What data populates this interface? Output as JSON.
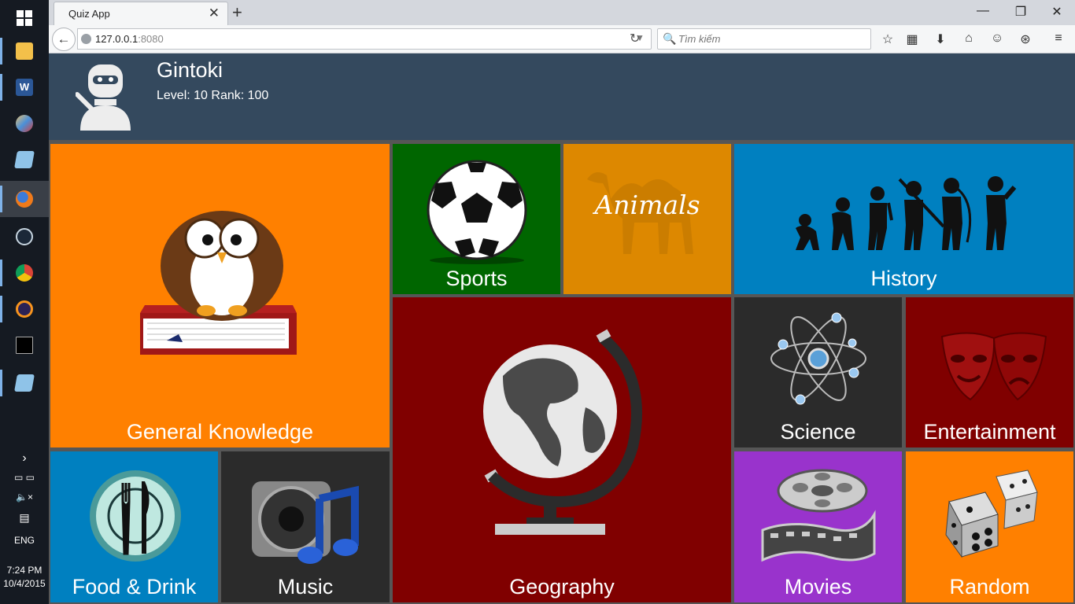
{
  "browser": {
    "tab_title": "Quiz App",
    "url_host": "127.0.0.1",
    "url_port": ":8080",
    "search_placeholder": "Tìm kiếm"
  },
  "taskbar": {
    "language": "ENG",
    "time": "7:24 PM",
    "date": "10/4/2015"
  },
  "profile": {
    "username": "Gintoki",
    "level_rank": "Level: 10 Rank: 100"
  },
  "categories": [
    {
      "label": "General Knowledge",
      "color": "#ff8000",
      "icon": "owl-on-book-icon"
    },
    {
      "label": "Sports",
      "color": "#006600",
      "icon": "soccer-ball-icon"
    },
    {
      "label": "Animals",
      "color": "#dd8800",
      "icon": "camel-icon"
    },
    {
      "label": "History",
      "color": "#0080c0",
      "icon": "evolution-icon"
    },
    {
      "label": "Geography",
      "color": "#800000",
      "icon": "globe-icon"
    },
    {
      "label": "Science",
      "color": "#2b2b2b",
      "icon": "atom-icon"
    },
    {
      "label": "Entertainment",
      "color": "#800000",
      "icon": "theater-masks-icon"
    },
    {
      "label": "Food & Drink",
      "color": "#0080c0",
      "icon": "plate-fork-knife-icon"
    },
    {
      "label": "Music",
      "color": "#2b2b2b",
      "icon": "speaker-music-note-icon"
    },
    {
      "label": "Movies",
      "color": "#9933cc",
      "icon": "film-reel-icon"
    },
    {
      "label": "Random",
      "color": "#ff8000",
      "icon": "dice-icon"
    }
  ]
}
